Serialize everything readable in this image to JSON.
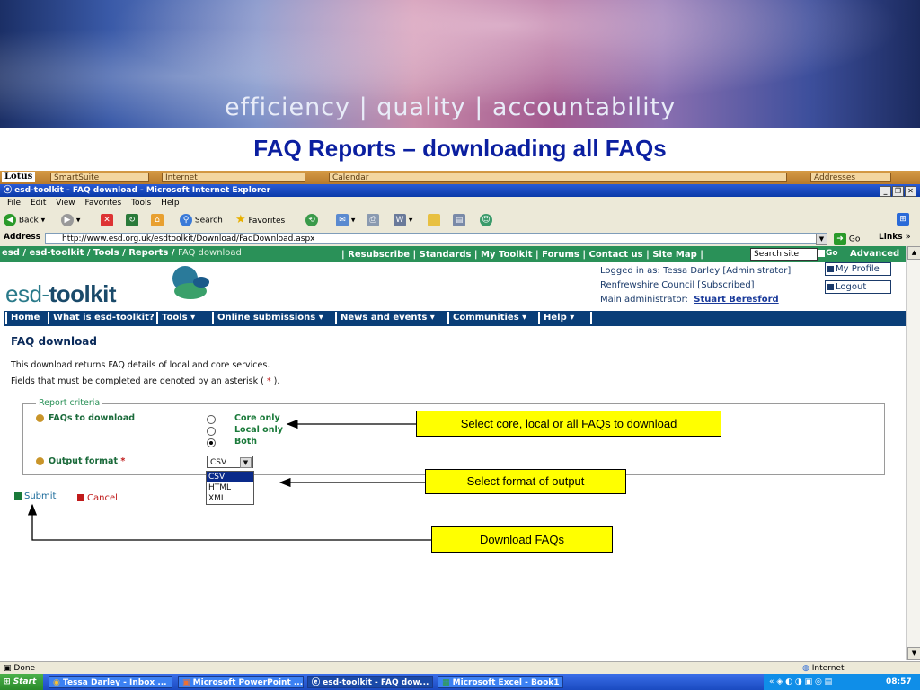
{
  "slide": {
    "tagline": "efficiency | quality | accountability",
    "title": "FAQ Reports – downloading all FAQs"
  },
  "lotus_bar": {
    "logo": "Lotus",
    "segments": [
      "SmartSuite",
      "Internet",
      "Calendar",
      "Addresses"
    ]
  },
  "browser": {
    "window_title": "esd-toolkit - FAQ download - Microsoft Internet Explorer",
    "menu": [
      "File",
      "Edit",
      "View",
      "Favorites",
      "Tools",
      "Help"
    ],
    "toolbar": {
      "back": "Back",
      "search": "Search",
      "favorites": "Favorites"
    },
    "address_label": "Address",
    "url": "http://www.esd.org.uk/esdtoolkit/Download/FaqDownload.aspx",
    "go": "Go",
    "links": "Links",
    "status": "Done",
    "zone": "Internet"
  },
  "site": {
    "breadcrumb": {
      "parts": "esd / esd-toolkit / Tools / Reports /",
      "current": "FAQ download"
    },
    "top_links": "| Resubscribe | Standards | My Toolkit | Forums | Contact us | Site Map |",
    "search_placeholder": "Search site",
    "go": "Go",
    "advanced": "Advanced",
    "logo_pre": "esd-",
    "logo_main": "toolkit",
    "user": {
      "logged_in": "Logged in as: Tessa Darley  [Administrator]",
      "council": "Renfrewshire Council  [Subscribed]",
      "main_admin_label": "Main administrator:",
      "main_admin_name": "Stuart Beresford"
    },
    "my_profile": "My Profile",
    "logout": "Logout",
    "nav": [
      "Home",
      "What is esd-toolkit?",
      "Tools  ▾",
      "Online submissions  ▾",
      "News and events  ▾",
      "Communities  ▾",
      "Help  ▾"
    ]
  },
  "form": {
    "heading": "FAQ download",
    "intro": "This download returns FAQ details of local and core services.",
    "required_note_pre": "Fields that must be completed are denoted by an asterisk (",
    "required_star": "*",
    "required_note_post": ").",
    "legend": "Report criteria",
    "faqs_label": "FAQs to download",
    "options": [
      "Core only",
      "Local only",
      "Both"
    ],
    "selected_option": "Both",
    "output_label": "Output format",
    "output_value": "CSV",
    "format_options": [
      "CSV",
      "HTML",
      "XML"
    ],
    "submit": "Submit",
    "cancel": "Cancel"
  },
  "callouts": {
    "select_faqs": "Select core, local or all FAQs to download",
    "select_format": "Select format of output",
    "download": "Download FAQs"
  },
  "taskbar": {
    "start": "Start",
    "tasks": [
      "Tessa Darley - Inbox ...",
      "Microsoft PowerPoint ...",
      "esd-toolkit - FAQ dow...",
      "Microsoft Excel - Book1"
    ],
    "clock": "08:57"
  }
}
